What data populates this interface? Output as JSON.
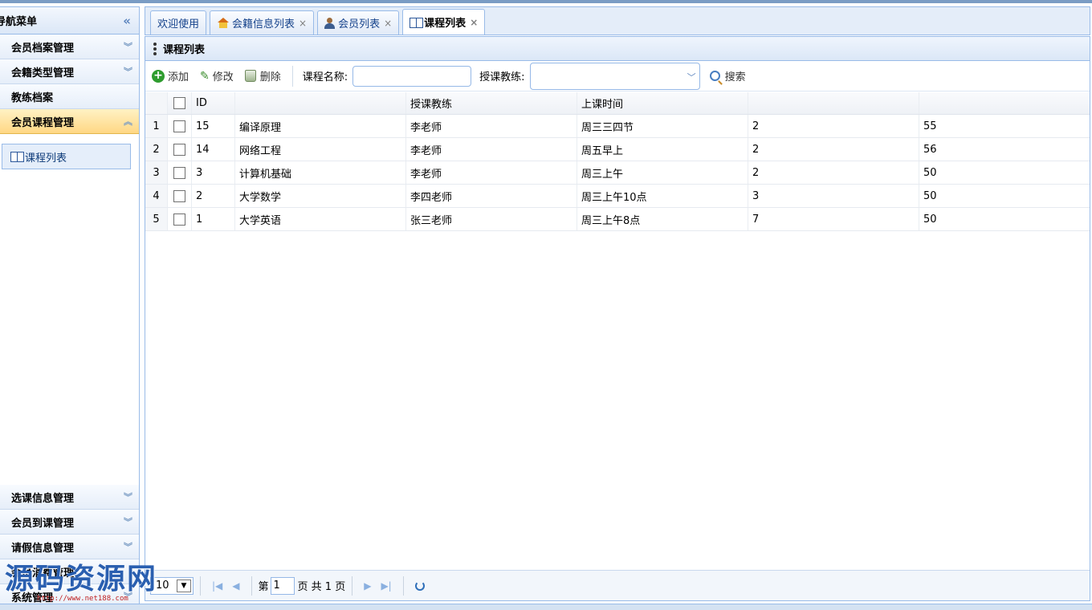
{
  "sidebar": {
    "title": "导航菜单",
    "collapse_icon": "double-chevron-left-icon",
    "top_items": [
      {
        "label": "会员档案管理"
      },
      {
        "label": "会籍类型管理"
      },
      {
        "label": "教练档案"
      },
      {
        "label": "会员课程管理",
        "active": true
      }
    ],
    "active_link": "课程列表",
    "bottom_items": [
      {
        "label": "选课信息管理"
      },
      {
        "label": "会员到课管理"
      },
      {
        "label": "请假信息管理"
      },
      {
        "label": "会员消费管理"
      },
      {
        "label": "系统管理"
      }
    ]
  },
  "tabs": [
    {
      "label": "欢迎使用",
      "icon": "",
      "closable": false
    },
    {
      "label": "会籍信息列表",
      "icon": "house-icon",
      "closable": true
    },
    {
      "label": "会员列表",
      "icon": "user-icon",
      "closable": true
    },
    {
      "label": "课程列表",
      "icon": "book-icon",
      "closable": true,
      "selected": true
    }
  ],
  "panel": {
    "title": "课程列表"
  },
  "toolbar": {
    "add_label": "添加",
    "edit_label": "修改",
    "delete_label": "删除",
    "course_name_label": "课程名称:",
    "course_name_value": "",
    "coach_label": "授课教练:",
    "coach_value": "",
    "search_label": "搜索"
  },
  "grid": {
    "headers": [
      "ID",
      "",
      "授课教练",
      "上课时间",
      "",
      ""
    ],
    "rows": [
      {
        "num": "1",
        "id": "15",
        "name": "编译原理",
        "coach": "李老师",
        "time": "周三三四节",
        "a": "2",
        "b": "55"
      },
      {
        "num": "2",
        "id": "14",
        "name": "网络工程",
        "coach": "李老师",
        "time": "周五早上",
        "a": "2",
        "b": "56"
      },
      {
        "num": "3",
        "id": "3",
        "name": "计算机基础",
        "coach": "李老师",
        "time": "周三上午",
        "a": "2",
        "b": "50"
      },
      {
        "num": "4",
        "id": "2",
        "name": "大学数学",
        "coach": "李四老师",
        "time": "周三上午10点",
        "a": "3",
        "b": "50"
      },
      {
        "num": "5",
        "id": "1",
        "name": "大学英语",
        "coach": "张三老师",
        "time": "周三上午8点",
        "a": "7",
        "b": "50"
      }
    ]
  },
  "pager": {
    "page_size": "10",
    "page_prefix": "第",
    "page_value": "1",
    "page_suffix": "页 共 1 页"
  },
  "watermark": {
    "text": "源码资源网",
    "url": "http://www.net188.com"
  },
  "colors": {
    "border": "#99bbe8",
    "active_item": "#ffd784",
    "link": "#0e3b79"
  }
}
